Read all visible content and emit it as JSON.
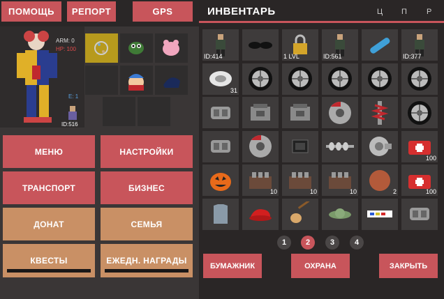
{
  "top_buttons": {
    "help": "ПОМОЩЬ",
    "report": "РЕПОРТ",
    "gps": "GPS"
  },
  "character": {
    "arm": "ARM: 0",
    "hp": "HP: 100",
    "e": "E: 1",
    "id": "ID:516"
  },
  "menu": {
    "menu": "МЕНЮ",
    "settings": "НАСТРОЙКИ",
    "transport": "ТРАНСПОРТ",
    "business": "БИЗНЕС",
    "donate": "ДОНАТ",
    "family": "СЕМЬЯ",
    "quests": "КВЕСТЫ",
    "daily": "ЕЖЕДН. НАГРАДЫ"
  },
  "inventory": {
    "title": "ИНВЕНТАРЬ",
    "sort_labels": [
      "Ц",
      "П",
      "Р"
    ],
    "items": [
      {
        "icon": "skin-icon",
        "label": "ID:414",
        "count": ""
      },
      {
        "icon": "sunglasses-icon",
        "label": "",
        "count": ""
      },
      {
        "icon": "lock-icon",
        "label": "1 LVL",
        "count": ""
      },
      {
        "icon": "skin-icon",
        "label": "ID:561",
        "count": ""
      },
      {
        "icon": "skateboard-icon",
        "label": "",
        "count": ""
      },
      {
        "icon": "skin-icon",
        "label": "ID:377",
        "count": ""
      },
      {
        "icon": "tire-kit-icon",
        "label": "",
        "count": "31"
      },
      {
        "icon": "wheel-icon",
        "label": "",
        "count": ""
      },
      {
        "icon": "wheel-icon",
        "label": "",
        "count": ""
      },
      {
        "icon": "wheel-icon",
        "label": "",
        "count": ""
      },
      {
        "icon": "wheel-icon",
        "label": "",
        "count": ""
      },
      {
        "icon": "wheel-icon",
        "label": "",
        "count": ""
      },
      {
        "icon": "gearbox-icon",
        "label": "",
        "count": ""
      },
      {
        "icon": "engine-icon",
        "label": "",
        "count": ""
      },
      {
        "icon": "engine-icon",
        "label": "",
        "count": ""
      },
      {
        "icon": "brake-disc-icon",
        "label": "",
        "count": ""
      },
      {
        "icon": "suspension-icon",
        "label": "",
        "count": ""
      },
      {
        "icon": "wheel-icon",
        "label": "",
        "count": ""
      },
      {
        "icon": "gearbox-icon",
        "label": "",
        "count": ""
      },
      {
        "icon": "brake-disc-icon",
        "label": "",
        "count": ""
      },
      {
        "icon": "chip-icon",
        "label": "",
        "count": ""
      },
      {
        "icon": "camshaft-icon",
        "label": "",
        "count": ""
      },
      {
        "icon": "turbo-icon",
        "label": "",
        "count": ""
      },
      {
        "icon": "medkit-icon",
        "label": "",
        "count": "100"
      },
      {
        "icon": "pumpkin-icon",
        "label": "",
        "count": ""
      },
      {
        "icon": "crate-icon",
        "label": "",
        "count": "10"
      },
      {
        "icon": "crate-icon",
        "label": "",
        "count": "10"
      },
      {
        "icon": "crate-icon",
        "label": "",
        "count": "10"
      },
      {
        "icon": "plate-icon",
        "label": "",
        "count": "2"
      },
      {
        "icon": "medkit-icon",
        "label": "",
        "count": "100"
      },
      {
        "icon": "armor-icon",
        "label": "",
        "count": ""
      },
      {
        "icon": "cap-icon",
        "label": "",
        "count": ""
      },
      {
        "icon": "guitar-icon",
        "label": "",
        "count": ""
      },
      {
        "icon": "yoda-icon",
        "label": "",
        "count": ""
      },
      {
        "icon": "plate-number-icon",
        "label": "",
        "count": ""
      },
      {
        "icon": "gearbox-icon",
        "label": "",
        "count": ""
      }
    ],
    "pages": [
      "1",
      "2",
      "3",
      "4"
    ],
    "active_page": "2",
    "buttons": {
      "wallet": "БУМАЖНИК",
      "guard": "ОХРАНА",
      "close": "ЗАКРЫТЬ"
    }
  },
  "colors": {
    "accent": "#c8555b",
    "tan": "#c99065",
    "panel": "#3a3636"
  }
}
